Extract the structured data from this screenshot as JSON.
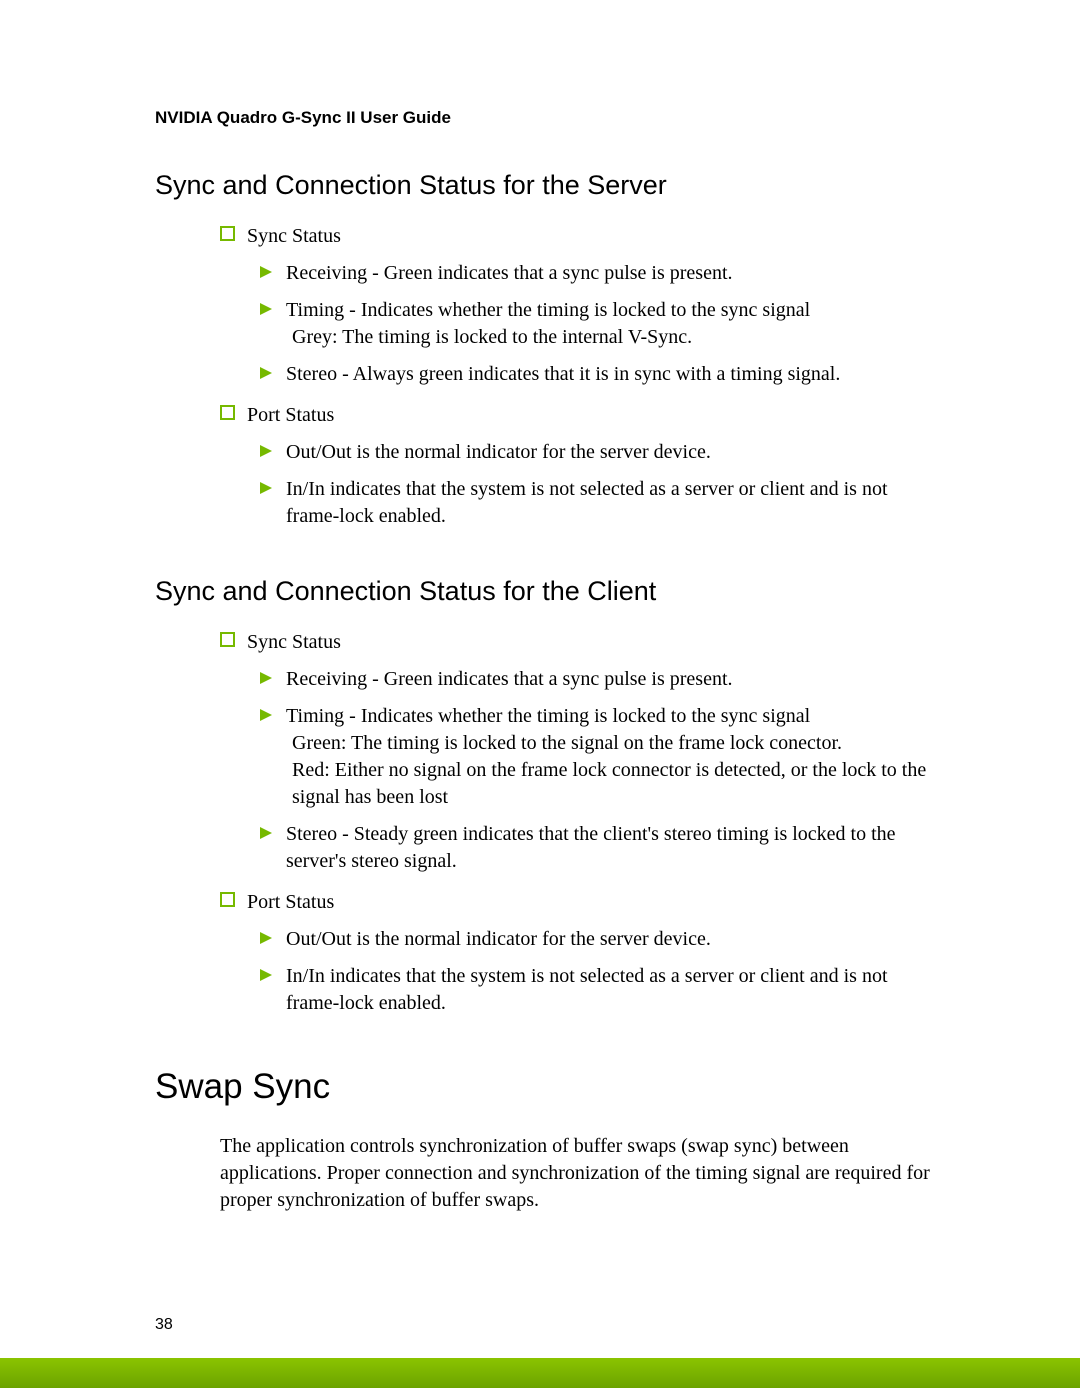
{
  "running_header": "NVIDIA Quadro G-Sync II User Guide",
  "page_number": "38",
  "section_server": {
    "title": "Sync and Connection Status for the Server",
    "sync_status_label": "Sync Status",
    "sync_items": {
      "receiving": "Receiving  - Green indicates that a sync pulse is present.",
      "timing_main": "Timing - Indicates whether the timing is locked to the sync signal",
      "timing_sub": "Grey: The timing is locked to the internal V-Sync.",
      "stereo": "Stereo - Always green indicates that it is in sync with a timing signal."
    },
    "port_status_label": "Port Status",
    "port_items": {
      "out": "Out/Out is the normal indicator for the server device.",
      "in": "In/In indicates that the system is not selected as a server or client and is not frame-lock enabled."
    }
  },
  "section_client": {
    "title": "Sync and Connection Status for the Client",
    "sync_status_label": "Sync Status",
    "sync_items": {
      "receiving": "Receiving  - Green indicates that a sync pulse is present.",
      "timing_main": "Timing - Indicates whether the timing is locked to the sync signal",
      "timing_sub1": "Green: The timing is locked to the signal on the frame lock conector.",
      "timing_sub2": "Red: Either no signal on the frame lock connector is detected, or the lock to the signal has been lost",
      "stereo": "Stereo - Steady green indicates that the client's stereo timing is locked to the server's stereo signal."
    },
    "port_status_label": "Port Status",
    "port_items": {
      "out": "Out/Out is the normal indicator for the server device.",
      "in": "In/In indicates that the system is not selected as a server or client and is not frame-lock enabled."
    }
  },
  "section_swap": {
    "title": "Swap Sync",
    "paragraph": "The application controls synchronization of buffer swaps (swap sync) between applications. Proper connection and synchronization of the timing signal are required for proper synchronization of buffer swaps."
  }
}
